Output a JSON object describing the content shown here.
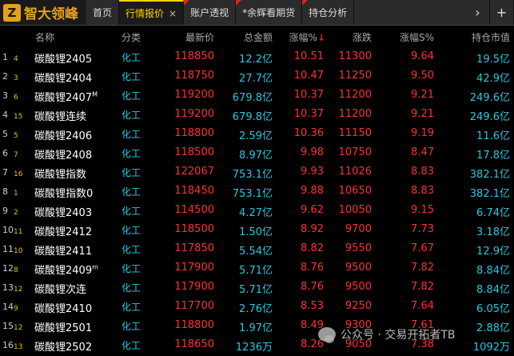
{
  "app": {
    "logo_text": "智大领峰",
    "logo_mark": "Z"
  },
  "tabs": [
    {
      "label": "首页",
      "active": false,
      "closable": false,
      "marked": false
    },
    {
      "label": "行情报价",
      "active": true,
      "closable": true,
      "marked": false
    },
    {
      "label": "账户透视",
      "active": false,
      "closable": false,
      "marked": true
    },
    {
      "label": "*余辉看期货",
      "active": false,
      "closable": false,
      "marked": true
    },
    {
      "label": "持仓分析",
      "active": false,
      "closable": false,
      "marked": true
    }
  ],
  "tab_controls": {
    "next": "›",
    "add": "+",
    "close": "×"
  },
  "columns": {
    "name": "名称",
    "category": "分类",
    "price": "最新价",
    "amount": "总金额",
    "pct": "涨幅%",
    "pct_sort": "↓",
    "change": "涨跌",
    "pct5": "涨幅S%",
    "oi": "持仓市值"
  },
  "rows": [
    {
      "i1": "1",
      "i2": "4",
      "name": "碳酸锂2405",
      "sup": "",
      "cat": "化工",
      "price": "118850",
      "amount": "12.2亿",
      "pct": "10.51",
      "chg": "11300",
      "pct5": "9.64",
      "oi": "19.5亿"
    },
    {
      "i1": "2",
      "i2": "3",
      "name": "碳酸锂2404",
      "sup": "",
      "cat": "化工",
      "price": "118750",
      "amount": "27.7亿",
      "pct": "10.47",
      "chg": "11250",
      "pct5": "9.50",
      "oi": "42.9亿"
    },
    {
      "i1": "3",
      "i2": "6",
      "name": "碳酸锂2407",
      "sup": "M",
      "cat": "化工",
      "price": "119200",
      "amount": "679.8亿",
      "pct": "10.37",
      "chg": "11200",
      "pct5": "9.21",
      "oi": "249.6亿"
    },
    {
      "i1": "4",
      "i2": "15",
      "name": "碳酸锂连续",
      "sup": "",
      "cat": "化工",
      "price": "119200",
      "amount": "679.8亿",
      "pct": "10.37",
      "chg": "11200",
      "pct5": "9.21",
      "oi": "249.6亿"
    },
    {
      "i1": "5",
      "i2": "5",
      "name": "碳酸锂2406",
      "sup": "",
      "cat": "化工",
      "price": "118800",
      "amount": "2.59亿",
      "pct": "10.36",
      "chg": "11150",
      "pct5": "9.19",
      "oi": "11.6亿"
    },
    {
      "i1": "6",
      "i2": "7",
      "name": "碳酸锂2408",
      "sup": "",
      "cat": "化工",
      "price": "118500",
      "amount": "8.97亿",
      "pct": "9.98",
      "chg": "10750",
      "pct5": "8.47",
      "oi": "17.8亿"
    },
    {
      "i1": "7",
      "i2": "16",
      "name": "碳酸锂指数",
      "sup": "",
      "cat": "化工",
      "price": "122067",
      "amount": "753.1亿",
      "pct": "9.93",
      "chg": "11026",
      "pct5": "8.83",
      "oi": "382.1亿"
    },
    {
      "i1": "8",
      "i2": "1",
      "name": "碳酸锂指数0",
      "sup": "",
      "cat": "化工",
      "price": "118450",
      "amount": "753.1亿",
      "pct": "9.88",
      "chg": "10650",
      "pct5": "8.83",
      "oi": "382.1亿"
    },
    {
      "i1": "9",
      "i2": "2",
      "name": "碳酸锂2403",
      "sup": "",
      "cat": "化工",
      "price": "114500",
      "amount": "4.27亿",
      "pct": "9.62",
      "chg": "10050",
      "pct5": "9.15",
      "oi": "6.74亿"
    },
    {
      "i1": "10",
      "i2": "11",
      "name": "碳酸锂2412",
      "sup": "",
      "cat": "化工",
      "price": "118500",
      "amount": "1.50亿",
      "pct": "8.92",
      "chg": "9700",
      "pct5": "7.73",
      "oi": "3.18亿"
    },
    {
      "i1": "11",
      "i2": "10",
      "name": "碳酸锂2411",
      "sup": "",
      "cat": "化工",
      "price": "117850",
      "amount": "5.54亿",
      "pct": "8.82",
      "chg": "9550",
      "pct5": "7.67",
      "oi": "12.9亿"
    },
    {
      "i1": "12",
      "i2": "8",
      "name": "碳酸锂2409",
      "sup": "m",
      "cat": "化工",
      "price": "117900",
      "amount": "5.71亿",
      "pct": "8.76",
      "chg": "9500",
      "pct5": "7.82",
      "oi": "8.84亿"
    },
    {
      "i1": "13",
      "i2": "12",
      "name": "碳酸锂次连",
      "sup": "",
      "cat": "化工",
      "price": "117900",
      "amount": "5.71亿",
      "pct": "8.76",
      "chg": "9500",
      "pct5": "7.82",
      "oi": "8.84亿"
    },
    {
      "i1": "14",
      "i2": "9",
      "name": "碳酸锂2410",
      "sup": "",
      "cat": "化工",
      "price": "117700",
      "amount": "2.76亿",
      "pct": "8.53",
      "chg": "9250",
      "pct5": "7.64",
      "oi": "6.05亿"
    },
    {
      "i1": "15",
      "i2": "12",
      "name": "碳酸锂2501",
      "sup": "",
      "cat": "化工",
      "price": "118800",
      "amount": "1.97亿",
      "pct": "8.49",
      "chg": "9300",
      "pct5": "7.61",
      "oi": "2.88亿"
    },
    {
      "i1": "16",
      "i2": "13",
      "name": "碳酸锂2502",
      "sup": "",
      "cat": "化工",
      "price": "118650",
      "amount": "1236万",
      "pct": "8.26",
      "chg": "9050",
      "pct5": "7.38",
      "oi": "1092万"
    }
  ],
  "watermark": "公众号 · 交易开拓者TB",
  "colors": {
    "up": "#ff3030",
    "cyan": "#28c8e0",
    "accent": "#ffd200",
    "logo": "#e5a11c"
  }
}
